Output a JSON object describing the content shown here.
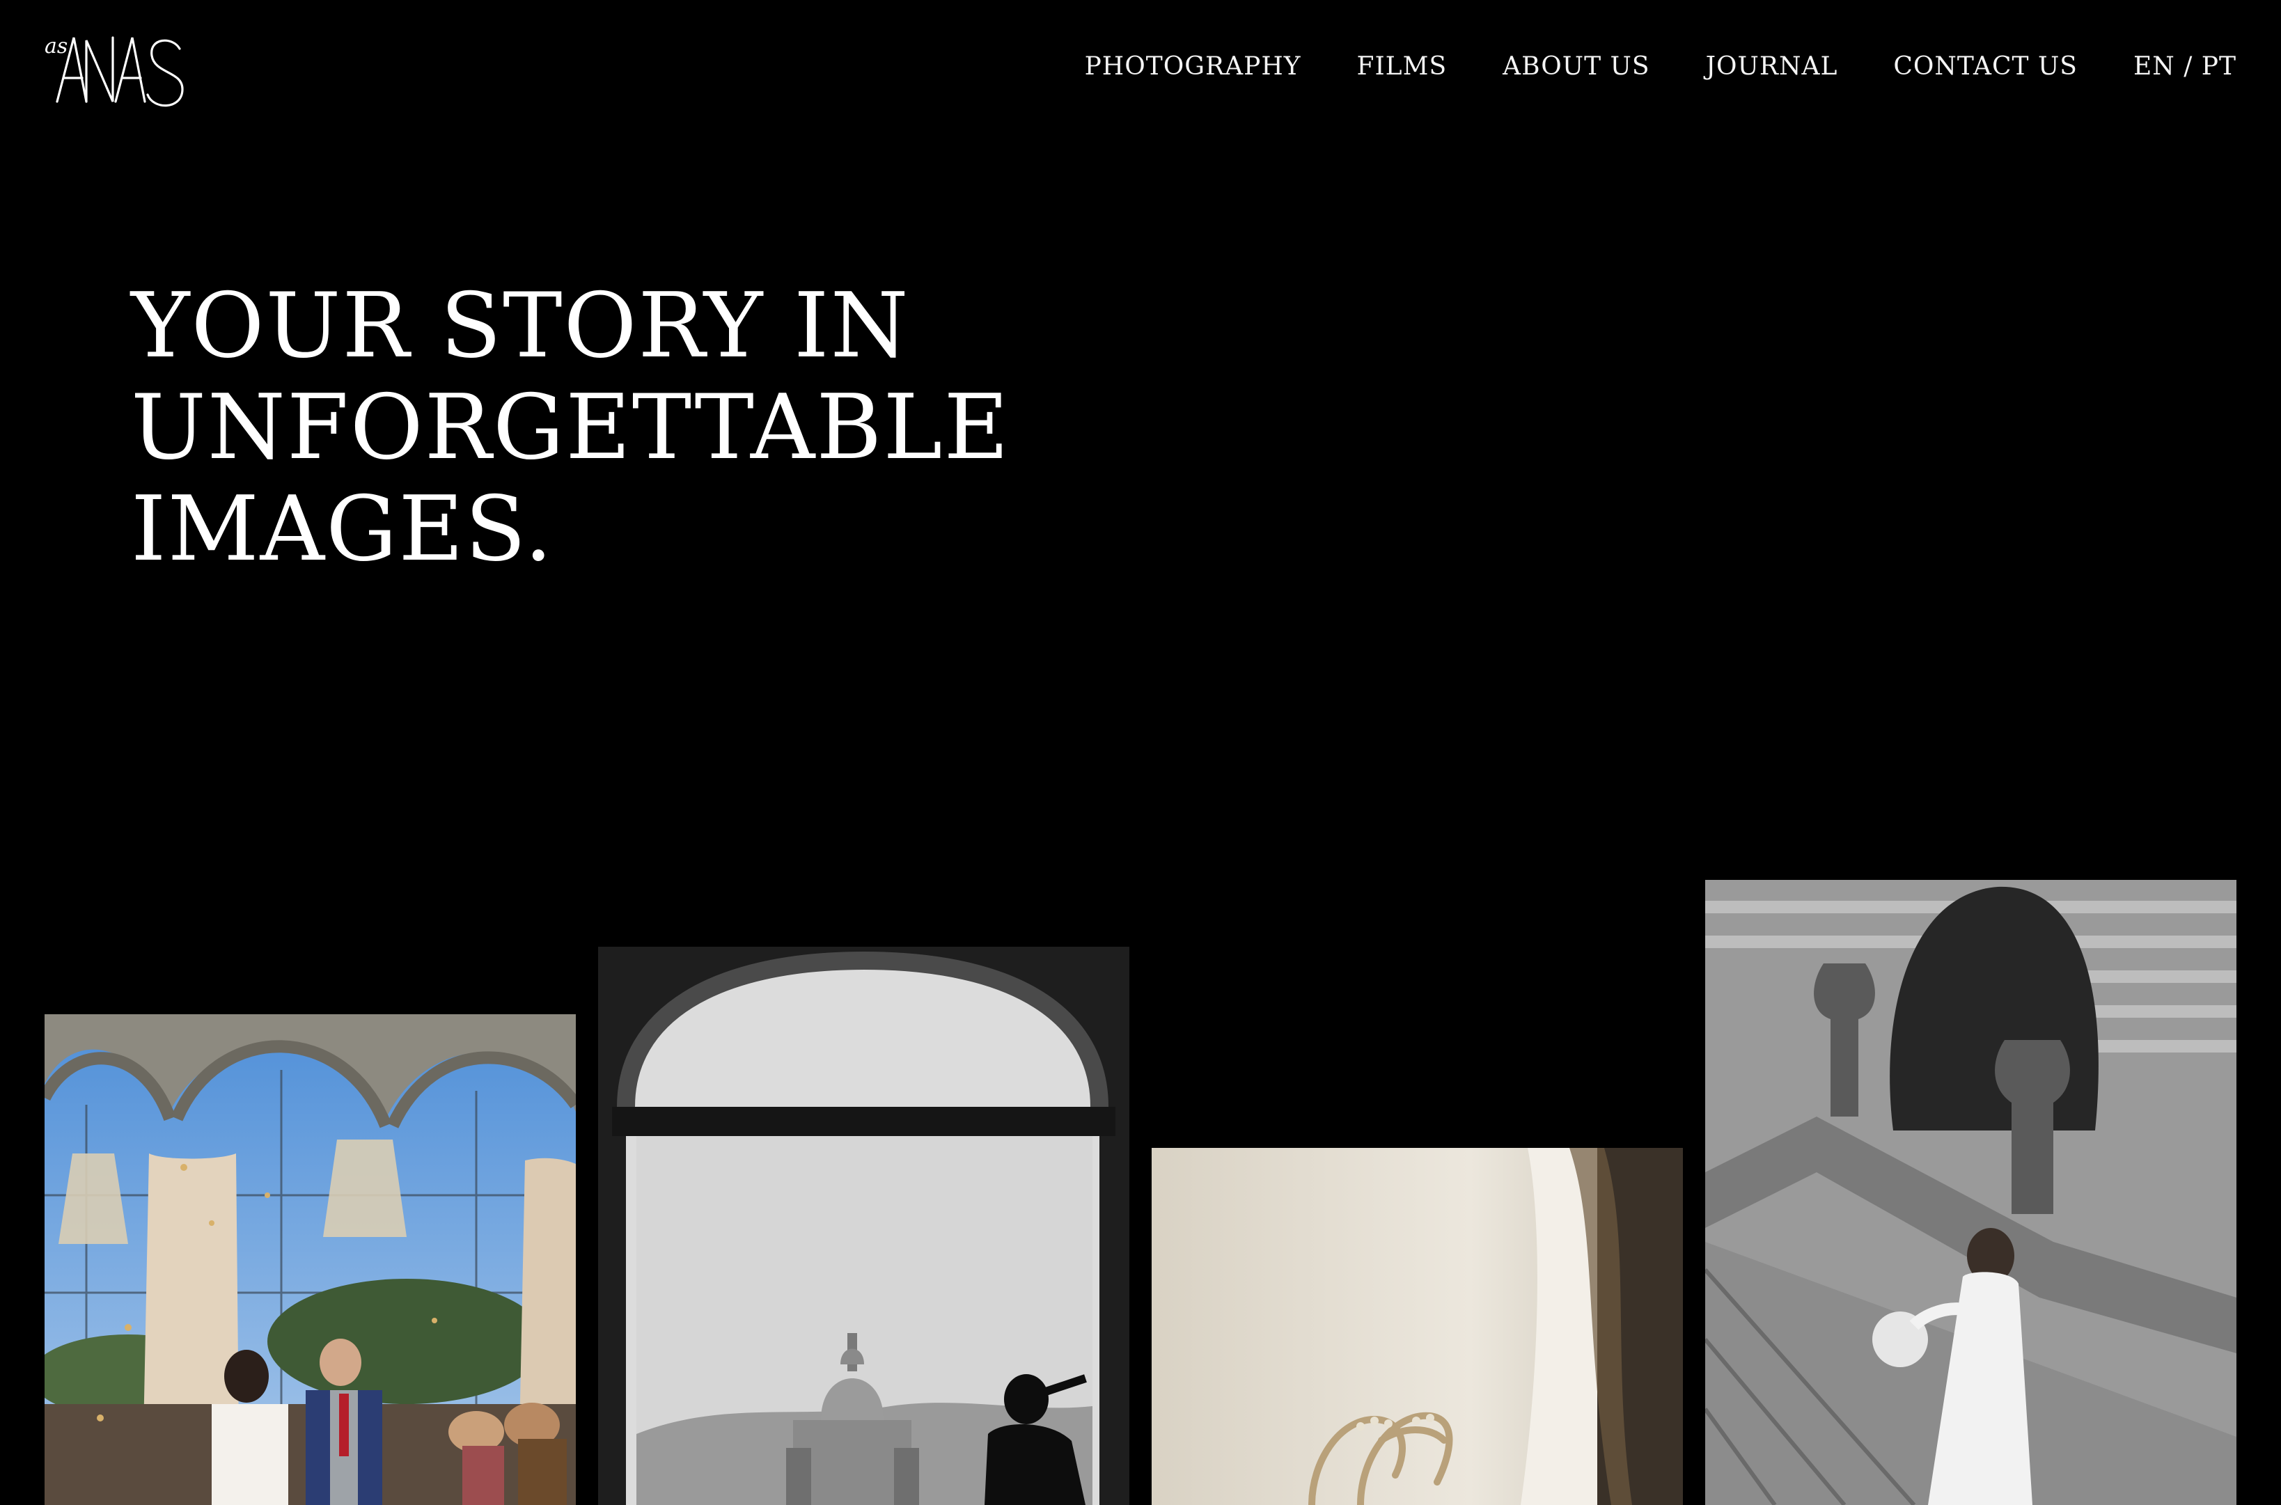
{
  "brand": {
    "logo_text": "as ANAS"
  },
  "nav": {
    "items": [
      {
        "label": "PHOTOGRAPHY"
      },
      {
        "label": "FILMS"
      },
      {
        "label": "ABOUT US"
      },
      {
        "label": "JOURNAL"
      },
      {
        "label": "CONTACT US"
      },
      {
        "label": "EN / PT"
      }
    ]
  },
  "hero": {
    "lines": [
      "YOUR STORY IN",
      "UNFORGETTABLE",
      "IMAGES."
    ]
  },
  "gallery": {
    "photos": [
      {
        "subject": "wedding-ceremony-exit-color"
      },
      {
        "subject": "groom-window-basilica-bw"
      },
      {
        "subject": "bridal-shoes-detail"
      },
      {
        "subject": "bride-garden-staircase-bw",
        "visible_text": ""
      }
    ]
  },
  "colors": {
    "background": "#000000",
    "text": "#ffffff"
  }
}
